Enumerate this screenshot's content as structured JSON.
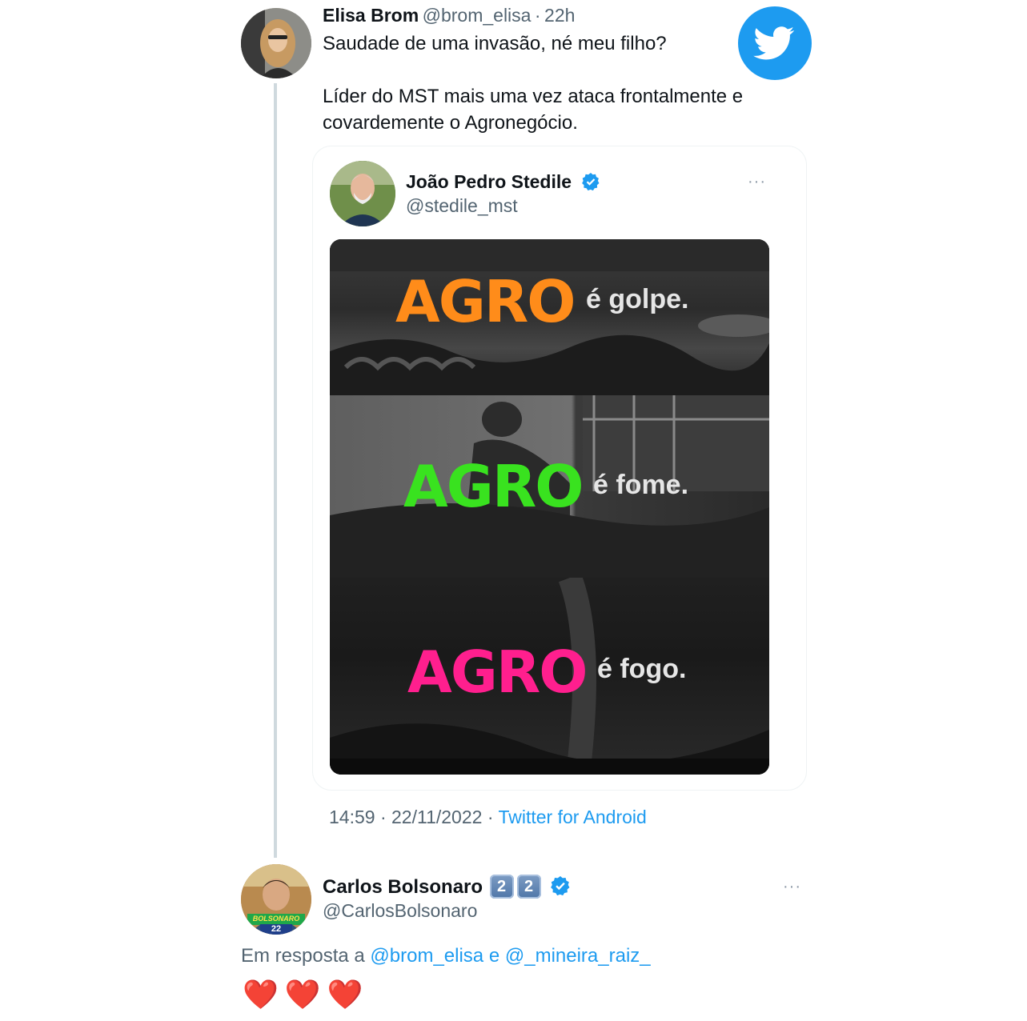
{
  "main_tweet": {
    "author_name": "Elisa Brom",
    "author_handle": "@brom_elisa",
    "separator": "·",
    "time_ago": "22h",
    "text_line1": "Saudade de uma invasão, né meu filho?",
    "text_line2": "Líder do MST mais uma vez ataca frontalmente e",
    "text_line3": "covardemente o Agronegócio.",
    "footer_time": "14:59",
    "footer_date": "22/11/2022",
    "footer_dot": "·",
    "footer_source": "Twitter for Android"
  },
  "quoted_tweet": {
    "author_name": "João Pedro Stedile",
    "author_handle": "@stedile_mst",
    "more_label": "···",
    "media": {
      "lines": [
        {
          "word": "AGRO",
          "suffix": "é golpe.",
          "color": "#ff8c1a"
        },
        {
          "word": "AGRO",
          "suffix": "é fome.",
          "color": "#39e21f"
        },
        {
          "word": "AGRO",
          "suffix": "é fogo.",
          "color": "#ff1f8e"
        }
      ]
    }
  },
  "reply_tweet": {
    "author_name": "Carlos Bolsonaro",
    "badge_digits": [
      "2",
      "2"
    ],
    "author_handle": "@CarlosBolsonaro",
    "more_label": "···",
    "reply_prefix": "Em resposta a",
    "mention1": "@brom_elisa",
    "conjunction": "e",
    "mention2": "@_mineira_raiz_",
    "avatar_text_top": "BOLSONARO",
    "avatar_text_bottom": "22",
    "hearts": [
      "❤️",
      "❤️",
      "❤️"
    ]
  },
  "colors": {
    "accent": "#1d9bf0",
    "twitter_logo": "#1d9bf0",
    "muted": "#536471",
    "thread_line": "#cfd9de"
  },
  "icons": [
    "twitter-bird-icon",
    "verified-badge-icon",
    "more-options-icon"
  ]
}
